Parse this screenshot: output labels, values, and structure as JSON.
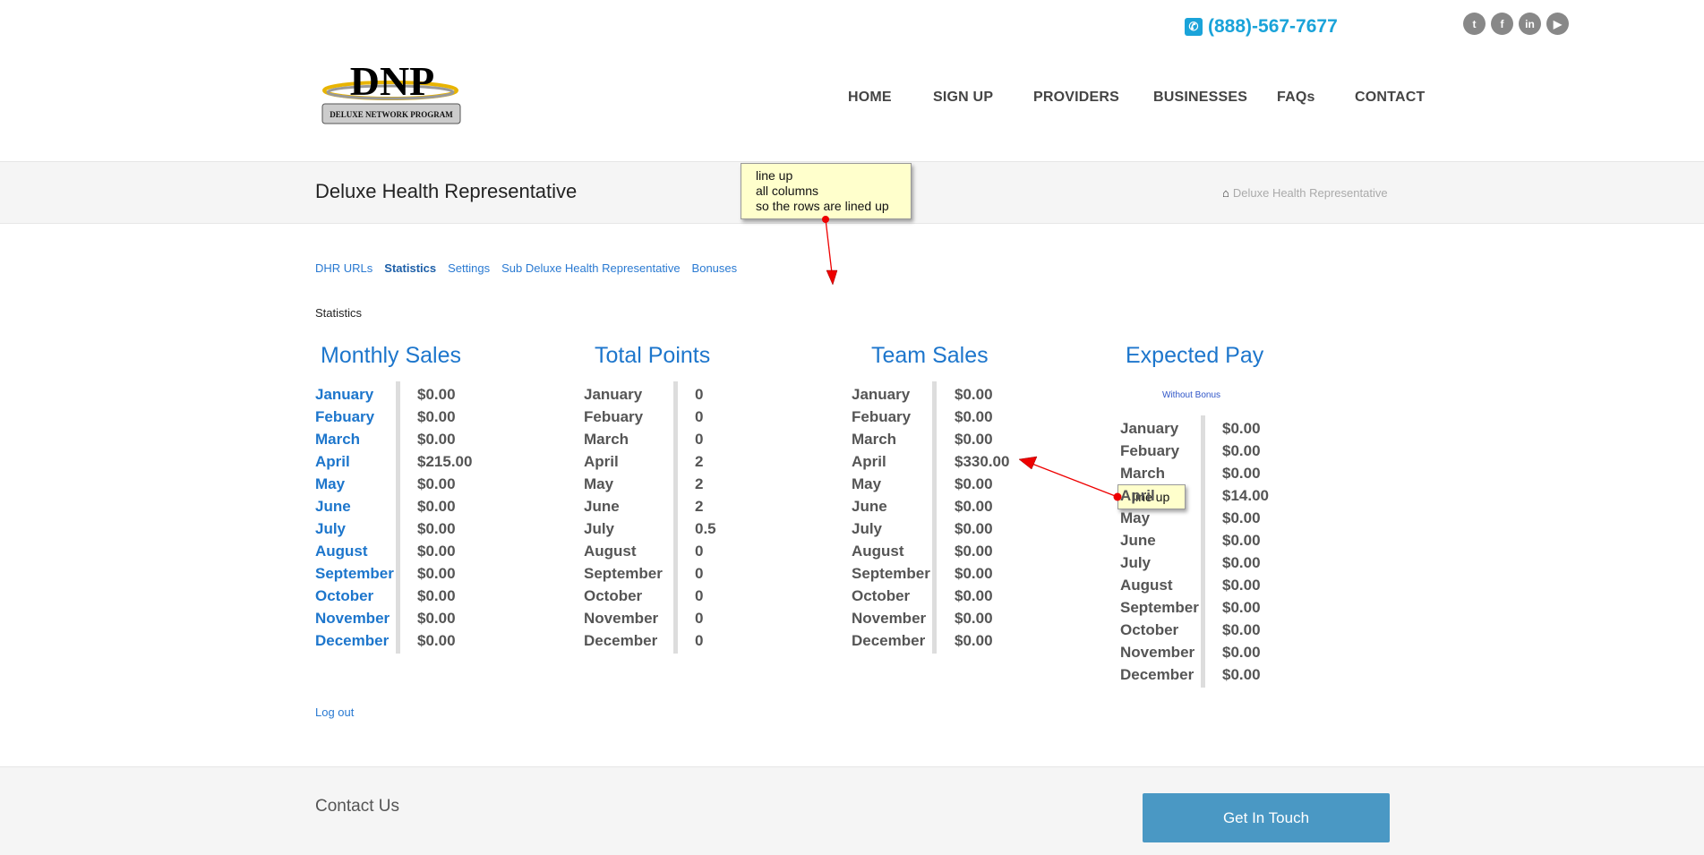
{
  "header": {
    "phone": "(888)-567-7677",
    "social": [
      "twitter",
      "facebook",
      "linkedin",
      "youtube"
    ],
    "logo": {
      "big": "DNP",
      "small": "DELUXE NETWORK PROGRAM"
    },
    "nav": [
      "HOME",
      "SIGN UP",
      "PROVIDERS",
      "BUSINESSES",
      "FAQs",
      "CONTACT"
    ]
  },
  "page": {
    "title": "Deluxe Health Representative",
    "breadcrumb": "Deluxe Health Representative"
  },
  "annotations": {
    "note1": [
      "line up",
      "all columns",
      "so the rows are lined up"
    ],
    "note2": "line up"
  },
  "tabs": [
    "DHR URLs",
    "Statistics",
    "Settings",
    "Sub Deluxe Health Representative",
    "Bonuses"
  ],
  "section_title": "Statistics",
  "months": [
    "January",
    "Febuary",
    "March",
    "April",
    "May",
    "June",
    "July",
    "August",
    "September",
    "October",
    "November",
    "December"
  ],
  "columns": [
    {
      "title": "Monthly Sales",
      "values": [
        "$0.00",
        "$0.00",
        "$0.00",
        "$215.00",
        "$0.00",
        "$0.00",
        "$0.00",
        "$0.00",
        "$0.00",
        "$0.00",
        "$0.00",
        "$0.00"
      ]
    },
    {
      "title": "Total Points",
      "values": [
        "0",
        "0",
        "0",
        "2",
        "2",
        "2",
        "0.5",
        "0",
        "0",
        "0",
        "0",
        "0"
      ]
    },
    {
      "title": "Team Sales",
      "values": [
        "$0.00",
        "$0.00",
        "$0.00",
        "$330.00",
        "$0.00",
        "$0.00",
        "$0.00",
        "$0.00",
        "$0.00",
        "$0.00",
        "$0.00",
        "$0.00"
      ]
    },
    {
      "title": "Expected Pay",
      "subtitle": "Without Bonus",
      "values": [
        "$0.00",
        "$0.00",
        "$0.00",
        "$14.00",
        "$0.00",
        "$0.00",
        "$0.00",
        "$0.00",
        "$0.00",
        "$0.00",
        "$0.00",
        "$0.00"
      ]
    }
  ],
  "logout": "Log out",
  "footer": {
    "contact": "Contact Us",
    "button": "Get In Touch"
  }
}
